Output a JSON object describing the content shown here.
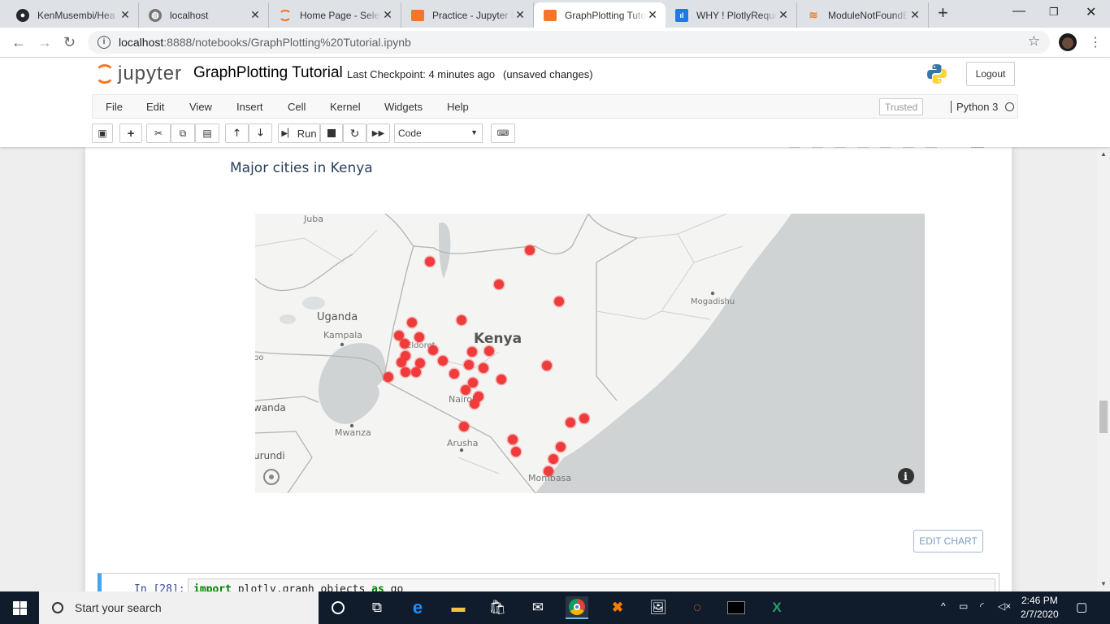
{
  "browser": {
    "tabs": [
      {
        "title": "KenMusembi/Hea",
        "icon": "github-icon"
      },
      {
        "title": "localhost",
        "icon": "globe-icon"
      },
      {
        "title": "Home Page - Selec",
        "icon": "jupyter-icon"
      },
      {
        "title": "Practice - Jupyter N",
        "icon": "notebook-icon"
      },
      {
        "title": "GraphPlotting Tuto",
        "icon": "notebook-icon",
        "active": true
      },
      {
        "title": "WHY ! PlotlyReque",
        "icon": "chart-icon"
      },
      {
        "title": "ModuleNotFoundEr",
        "icon": "stackoverflow-icon"
      }
    ],
    "url_host": "localhost",
    "url_rest": ":8888/notebooks/GraphPlotting%20Tutorial.ipynb"
  },
  "jupyter": {
    "logo_text": "jupyter",
    "notebook_title": "GraphPlotting Tutorial",
    "checkpoint": "Last Checkpoint: 4 minutes ago",
    "save_status": "(unsaved changes)",
    "logout_label": "Logout",
    "menu": [
      "File",
      "Edit",
      "View",
      "Insert",
      "Cell",
      "Kernel",
      "Widgets",
      "Help"
    ],
    "trusted_label": "Trusted",
    "kernel_name": "Python 3",
    "toolbar": {
      "run_label": "Run",
      "cell_type": "Code"
    }
  },
  "plot": {
    "title": "Major cities in Kenya",
    "labels": {
      "country": "Kenya",
      "uganda": "Uganda",
      "juba": "Juba",
      "kampala": "Kampala",
      "mogadishu": "Mogadishu",
      "eldoret": "Eldoret",
      "nairobi": "Nairobi",
      "mwanza": "Mwanza",
      "arusha": "Arusha",
      "mombasa": "Mombasa",
      "rwanda": "wanda",
      "burundi": "urundi",
      "bo": "bo"
    },
    "marker_color": "#ef3b3b",
    "edit_chart_label": "EDIT CHART"
  },
  "code_cell": {
    "prompt": "In [28]:",
    "kw_import": "import",
    "module": "plotly.graph_objects",
    "kw_as": "as",
    "alias": "go"
  },
  "taskbar": {
    "search_placeholder": "Start your search",
    "time": "2:46 PM",
    "date": "2/7/2020"
  }
}
